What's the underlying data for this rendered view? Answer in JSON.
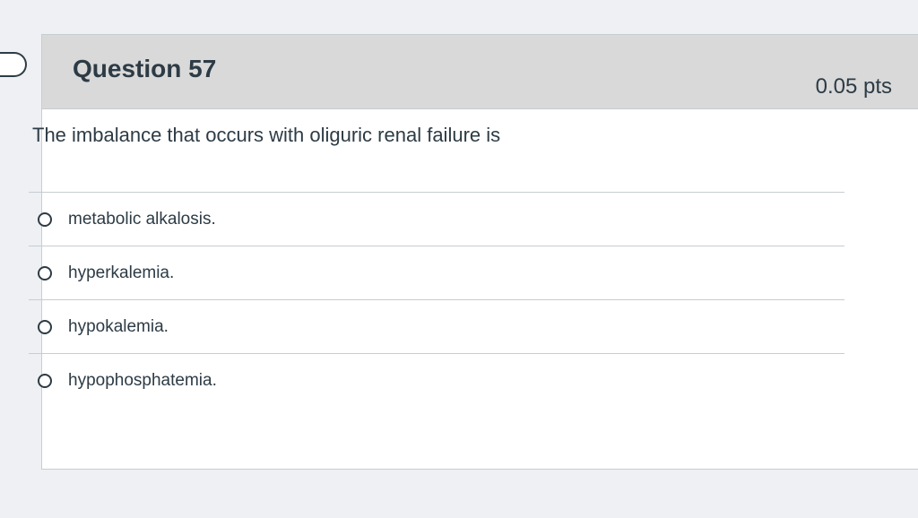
{
  "question": {
    "title": "Question 57",
    "points": "0.05 pts",
    "text": "The imbalance that occurs with oliguric renal failure is"
  },
  "answers": [
    {
      "label": "metabolic alkalosis.",
      "selected": false
    },
    {
      "label": "hyperkalemia.",
      "selected": false
    },
    {
      "label": "hypokalemia.",
      "selected": false
    },
    {
      "label": "hypophosphatemia.",
      "selected": false
    }
  ],
  "colors": {
    "header_bg": "#d9d9d9",
    "text": "#2d3b45",
    "border": "#c7cdd1",
    "page_bg": "#eef0f3"
  }
}
